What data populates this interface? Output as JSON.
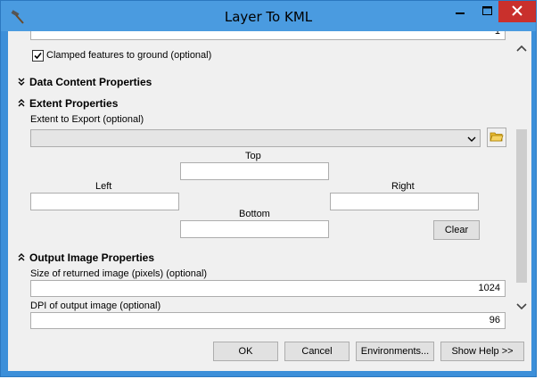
{
  "window": {
    "title": "Layer To KML",
    "icon": "hammer-icon",
    "minimize_icon": "minimize-icon",
    "maximize_icon": "maximize-icon",
    "close_icon": "close-icon"
  },
  "top_field": {
    "value": "1"
  },
  "clamped": {
    "label": "Clamped features to ground (optional)",
    "checked": true
  },
  "sections": {
    "data_content": {
      "label": "Data Content Properties",
      "state": "collapsed"
    },
    "extent": {
      "label": "Extent Properties",
      "state": "expanded"
    },
    "output_image": {
      "label": "Output Image Properties",
      "state": "expanded"
    }
  },
  "extent": {
    "export_label": "Extent to Export (optional)",
    "export_value": "",
    "top_label": "Top",
    "left_label": "Left",
    "right_label": "Right",
    "bottom_label": "Bottom",
    "top_value": "",
    "left_value": "",
    "right_value": "",
    "bottom_value": "",
    "clear_label": "Clear"
  },
  "output_image": {
    "size_label": "Size of returned image (pixels) (optional)",
    "size_value": "1024",
    "dpi_label": "DPI of output image (optional)",
    "dpi_value": "96"
  },
  "footer": {
    "ok": "OK",
    "cancel": "Cancel",
    "environments": "Environments...",
    "show_help": "Show Help >>"
  },
  "colors": {
    "titlebar": "#4a9be0",
    "close": "#c9302c",
    "client_bg": "#f0f0f0"
  }
}
